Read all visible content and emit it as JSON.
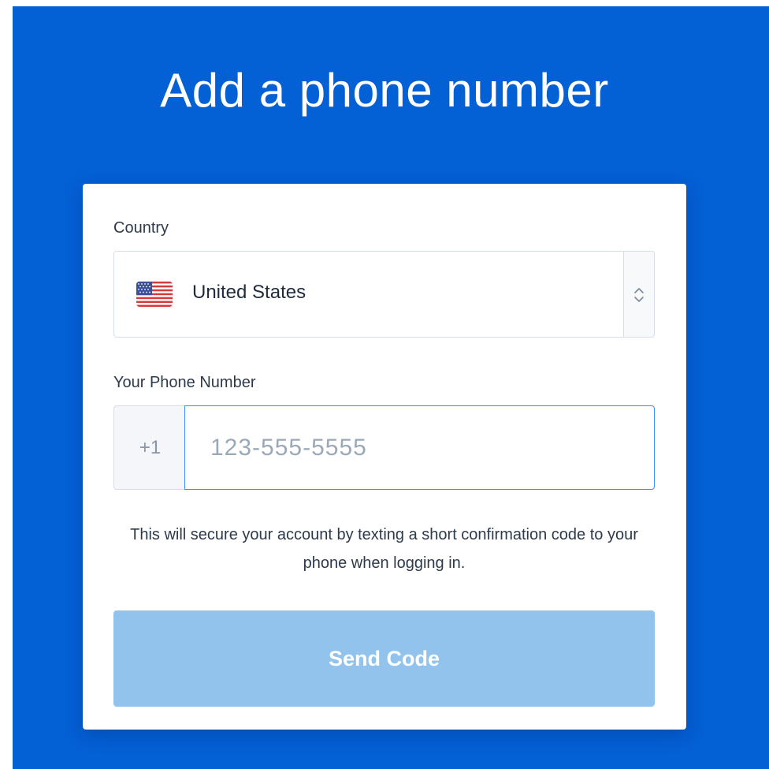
{
  "page": {
    "title": "Add a phone number",
    "background_color": "#0460d5"
  },
  "form": {
    "country_label": "Country",
    "country": {
      "flag_icon": "us-flag-icon",
      "selected": "United States"
    },
    "phone_label": "Your Phone Number",
    "phone": {
      "prefix": "+1",
      "value": "",
      "placeholder": "123-555-5555"
    },
    "helper_text": "This will secure your account by texting a short confirmation code to your phone when logging in.",
    "submit_label": "Send Code",
    "submit_disabled": true,
    "submit_color": "#92c3ed",
    "focus_color": "#3c8ef2"
  }
}
